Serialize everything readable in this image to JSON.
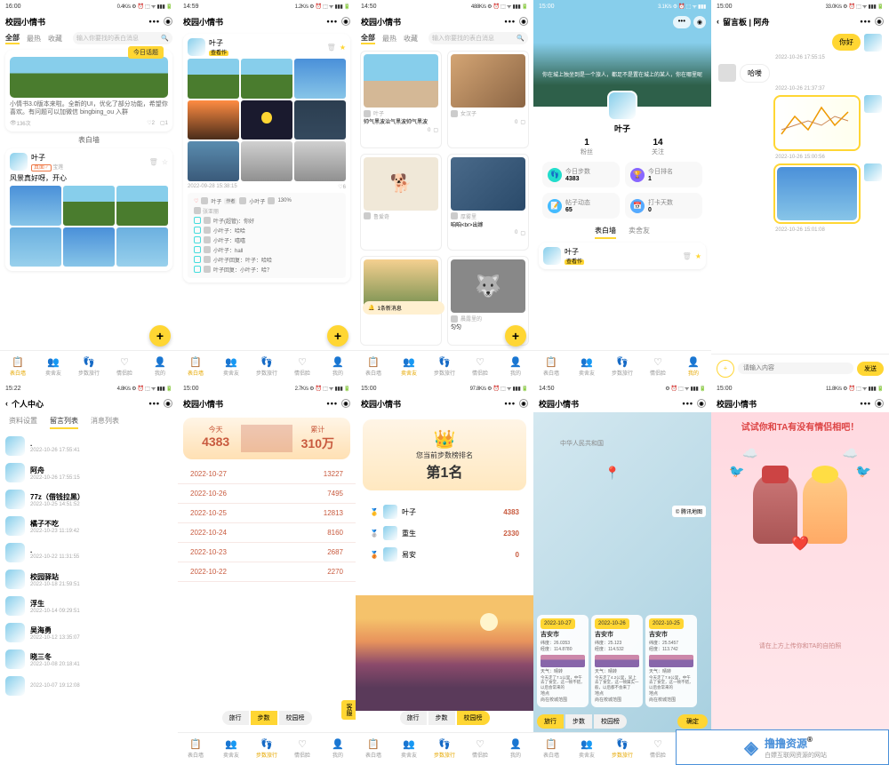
{
  "app_name": "校园小情书",
  "screens": {
    "s1": {
      "time": "16:00",
      "net": "0.4K/s",
      "title": "校园小情书",
      "tabs": [
        "全部",
        "最热",
        "收藏"
      ],
      "search_ph": "输入你要找的表白消息",
      "topic_tag": "今日话题",
      "topic_text": "小情书3.0版本来啦。全新的UI，优化了部分功能，希望你喜欢。有问题可以加微信 bingbing_ou 入群",
      "views": "136次",
      "likes": "2",
      "comments": "1",
      "section": "表白墙",
      "post_user": "叶子",
      "post_tag": "真面♂",
      "post_extra": "宝莲",
      "post_text": "风景真好呀，开心"
    },
    "s2": {
      "time": "14:59",
      "net": "1.2K/s",
      "title": "校园小情书",
      "user": "叶子",
      "badge": "查看作",
      "ts": "2022-09-28 15:38:15",
      "likes": "6",
      "author": "叶子",
      "author_role": "作者",
      "c1": "小叶子",
      "c1n": "130%",
      "comments": [
        {
          "u": "叶子",
          "r": "(超管)",
          "t": "你好"
        },
        {
          "u": "小叶子",
          "r": "",
          "t": "哈哈"
        },
        {
          "u": "小叶子",
          "r": "",
          "t": "嘻嘻"
        },
        {
          "u": "小叶子",
          "r": "",
          "t": "hall"
        },
        {
          "u": "小叶子回复",
          "r": "",
          "t": "叶子：哈哈"
        },
        {
          "u": "叶子回复",
          "r": "",
          "t": "小叶子：哈？"
        }
      ]
    },
    "s3": {
      "time": "14:50",
      "net": "488K/s",
      "title": "校园小情书",
      "tabs": [
        "全部",
        "最热",
        "收藏"
      ],
      "search_ph": "输入你要找的表白消息",
      "f1": {
        "u": "叶子",
        "t": "帅气黑波治气黑波帅气黑波",
        "l": "0"
      },
      "f2": {
        "u": "女汉子",
        "l": "0"
      },
      "f3": {
        "u": "厚雾里",
        "t": "咱咱<br>出嫁",
        "l": "0"
      },
      "f4": {
        "u": "晨露里的",
        "t": "匀匀"
      },
      "f5": {
        "u": "鲁爱奇"
      },
      "notif": "1条新消息"
    },
    "s4": {
      "time": "15:00",
      "net": "3.1K/s",
      "title": "",
      "quote": "你在城上独坐到是一个旅人，都足不是置在城上的某人，你在哪里呢",
      "user": "叶子",
      "fans_n": "1",
      "fans_l": "粉丝",
      "focus_n": "14",
      "focus_l": "关注",
      "st1_l": "今日步数",
      "st1_v": "4383",
      "st2_l": "今日排名",
      "st2_v": "1",
      "st3_l": "帖子动态",
      "st3_v": "65",
      "st4_l": "打卡天数",
      "st4_v": "0",
      "tabs": [
        "表白墙",
        "卖舍友"
      ],
      "post_user": "叶子",
      "post_badge": "查看作"
    },
    "s5": {
      "time": "15:00",
      "net": "33.0K/s",
      "title": "留言板 | 阿舟",
      "m1": "你好",
      "t1": "2022-10-26 17:55:15",
      "m2": "哈喽",
      "t2": "2022-10-26 21:37:37",
      "t3": "2022-10-26 15:00:56",
      "t4": "2022-10-26 15:01:08",
      "input_ph": "请输入内容",
      "send": "发送"
    },
    "s6": {
      "time": "15:22",
      "net": "4.8K/s",
      "title": "个人中心",
      "tabs": [
        "资料设置",
        "留言列表",
        "消息列表"
      ],
      "list": [
        {
          "n": ".",
          "t": "2022-10-26 17:55:41"
        },
        {
          "n": "阿舟",
          "t": "2022-10-26 17:55:15"
        },
        {
          "n": "77z（借钱拉黑）",
          "t": "2022-10-25 14:51:52"
        },
        {
          "n": "橘子不吃",
          "t": "2022-10-23 11:19:42"
        },
        {
          "n": ".",
          "t": "2022-10-22 11:31:55"
        },
        {
          "n": "校园驿站",
          "t": "2022-10-18 21:59:51"
        },
        {
          "n": "浮生",
          "t": "2022-10-14 09:29:51"
        },
        {
          "n": "吴海勇",
          "t": "2022-10-12 13:35:07"
        },
        {
          "n": "晓三冬",
          "t": "2022-10-08 20:18:41"
        },
        {
          "n": "",
          "t": "2022-10-07 19:12:08"
        }
      ]
    },
    "s7": {
      "time": "15:00",
      "net": "2.7K/s",
      "title": "校园小情书",
      "today_l": "今天",
      "today_v": "4383",
      "total_l": "累计",
      "total_v": "310万",
      "rows": [
        {
          "d": "2022-10-27",
          "v": "13227"
        },
        {
          "d": "2022-10-26",
          "v": "7495"
        },
        {
          "d": "2022-10-25",
          "v": "12813"
        },
        {
          "d": "2022-10-24",
          "v": "8160"
        },
        {
          "d": "2022-10-23",
          "v": "2687"
        },
        {
          "d": "2022-10-22",
          "v": "2270"
        }
      ],
      "pills": [
        "旅行",
        "步数",
        "校园榜"
      ],
      "svc": "客服"
    },
    "s8": {
      "time": "15:00",
      "net": "97.8K/s",
      "title": "校园小情书",
      "rank_t": "您当前步数榜排名",
      "rank_v": "第1名",
      "list": [
        {
          "n": "叶子",
          "v": "4383"
        },
        {
          "n": "重生",
          "v": "2330"
        },
        {
          "n": "易安",
          "v": "0"
        }
      ],
      "pills": [
        "旅行",
        "步数",
        "校园榜"
      ]
    },
    "s9": {
      "time": "14:50",
      "net": "",
      "title": "校园小情书",
      "country": "中华人民共和国",
      "map_src": "© 腾讯地图",
      "cards": [
        {
          "d": "2022-10-27",
          "c": "吉安市",
          "lat": "纬度：26.0353",
          "lng": "经度：114.8780",
          "w": "晴转",
          "wt": "今天走了7.1公里，中午去了食堂，这一顿不错，以后会常来的",
          "loc": "尚在校城范围"
        },
        {
          "d": "2022-10-26",
          "c": "吉安市",
          "lat": "纬度：25.123",
          "lng": "经度：114.532",
          "w": "晴转",
          "wt": "今天走了4.2公里，早上去了食堂，这一顿属实一般，以后都不会来了",
          "loc": "尚在校城范围"
        },
        {
          "d": "2022-10-25",
          "c": "吉安市",
          "lat": "纬度：25.5457",
          "lng": "经度：113.742",
          "w": "晴转",
          "wt": "今天走了7.6公里，中午去了食堂，这一顿不错，以后会常来的",
          "loc": "尚在校城范围"
        }
      ],
      "pills": [
        "旅行",
        "步数",
        "校园榜"
      ],
      "btn": "确定"
    },
    "s10": {
      "time": "15:00",
      "net": "11.8K/s",
      "title": "校园小情书",
      "slogan": "试试你和TA有没有情侣相吧！",
      "hint": "请在上方上传你和TA的自拍照"
    }
  },
  "nav": [
    "表白墙",
    "卖舍友",
    "步数旅行",
    "情侣脸",
    "我的"
  ],
  "watermark": {
    "t1": "撸撸资源",
    "sub": "白嫖互联网资源的网站"
  }
}
